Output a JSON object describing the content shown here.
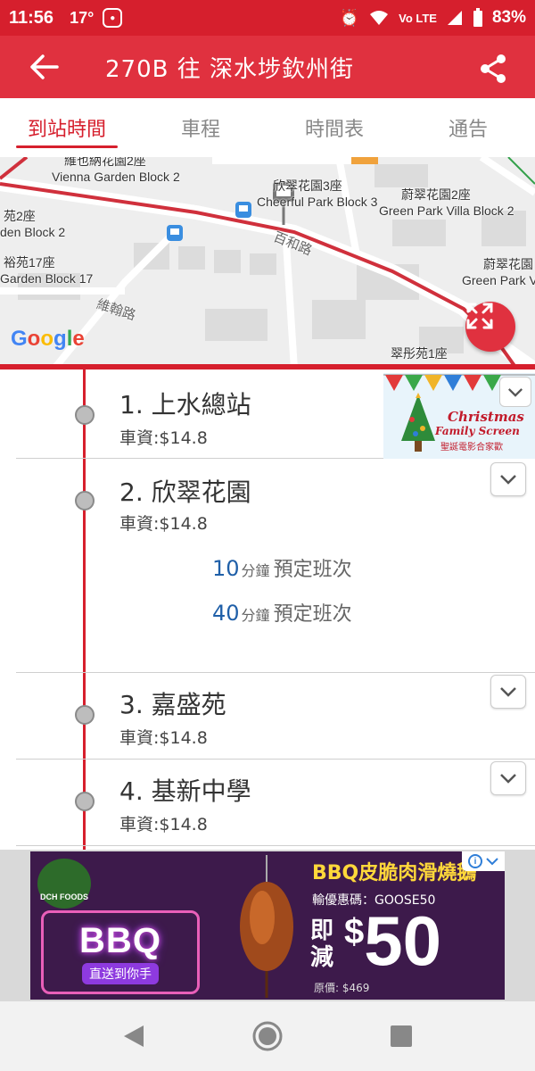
{
  "status_bar": {
    "time": "11:56",
    "temperature": "17°",
    "network": "Vo LTE",
    "battery": "83%"
  },
  "app_bar": {
    "title": "270B 往 深水埗欽州街"
  },
  "tabs": [
    {
      "label": "到站時間",
      "active": true
    },
    {
      "label": "車程",
      "active": false
    },
    {
      "label": "時間表",
      "active": false
    },
    {
      "label": "通告",
      "active": false
    }
  ],
  "map": {
    "labels": {
      "vienna": "維也納花園2座",
      "vienna_en": "Vienna Garden Block 2",
      "cheerful": "欣翠花園3座",
      "cheerful_en": "Cheerful Park Block 3",
      "green_park": "蔚翠花園2座",
      "green_park_en": "Green Park Villa Block 2",
      "left_block2": "苑2座",
      "left_block2_en": "den Block 2",
      "yuyuen": "裕苑17座",
      "yuyuen_en": "Garden Block 17",
      "baihe_road": "百和路",
      "weihan_road": "維翰路",
      "green_park_right": "蔚翠花園",
      "green_park_right_en": "Green Park Vil",
      "chuitung": "翠彤苑1座"
    },
    "google_logo": "Google"
  },
  "stops": [
    {
      "name": "1. 上水總站",
      "fare": "車資:$14.8"
    },
    {
      "name": "2. 欣翠花園",
      "fare": "車資:$14.8"
    },
    {
      "name": "3. 嘉盛苑",
      "fare": "車資:$14.8"
    },
    {
      "name": "4. 基新中學",
      "fare": "車資:$14.8"
    }
  ],
  "etas": [
    {
      "minutes": "10",
      "unit": "分鐘",
      "label": "預定班次"
    },
    {
      "minutes": "40",
      "unit": "分鐘",
      "label": "預定班次"
    }
  ],
  "xmas_ad": {
    "title": "Christmas",
    "subtitle": "Family Screen",
    "chinese": "聖誕電影合家歡"
  },
  "bbq_ad": {
    "brand": "DCH FOODS",
    "neon": "BBQ",
    "neon_sub": "直送到你手",
    "headline": "BBQ皮脆肉滑燒鵝",
    "promo_code": "輸優惠碼：GOOSE50",
    "discount_label": "即減",
    "currency": "$",
    "amount": "50",
    "original_price": "原價: $469"
  },
  "colors": {
    "primary": "#e0313f",
    "status_bar": "#d61f2d",
    "eta_minutes": "#1f5fa8"
  }
}
